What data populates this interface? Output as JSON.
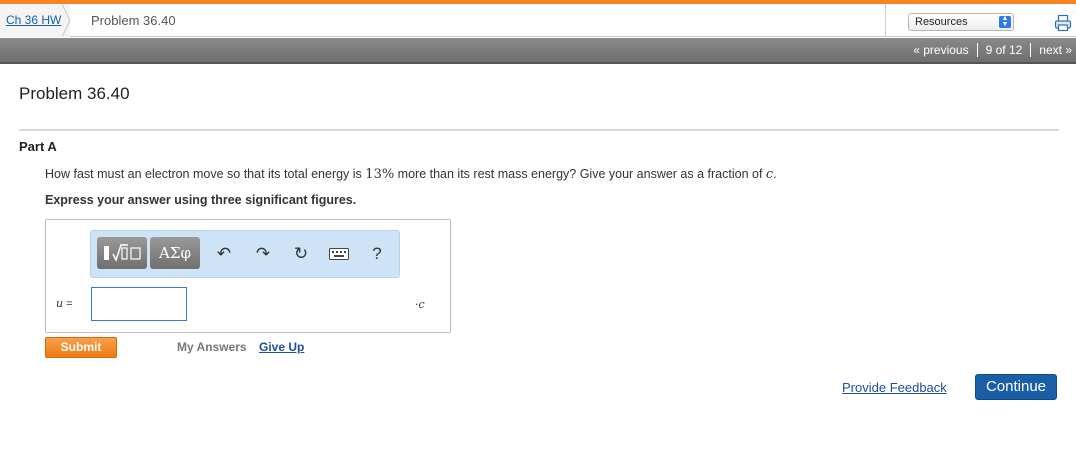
{
  "breadcrumb": {
    "home_label": "Ch 36 HW",
    "current_label": "Problem 36.40"
  },
  "resources": {
    "label": "Resources"
  },
  "pager": {
    "previous": "« previous",
    "position": "9 of 12",
    "next": "next »"
  },
  "page": {
    "title": "Problem 36.40"
  },
  "part": {
    "label": "Part A",
    "question_pre": "How fast must an electron move so that its total energy is ",
    "question_value": "13%",
    "question_post": " more than its rest mass energy? Give your answer as a fraction of ",
    "question_symbol": "c",
    "question_end": ".",
    "instruction": "Express your answer using three significant figures."
  },
  "answer": {
    "variable": "u",
    "equals": "=",
    "input_value": "",
    "unit": "·c",
    "toolbar": {
      "greek_label": "ΑΣφ",
      "help_label": "?"
    }
  },
  "actions": {
    "submit": "Submit",
    "my_answers": "My Answers",
    "give_up": "Give Up",
    "feedback": "Provide Feedback",
    "continue": "Continue"
  },
  "colors": {
    "accent": "#f7851f",
    "link": "#1a4f9c",
    "continue_bg": "#1a5ea8",
    "toolbar_bg": "#cfe3f7"
  },
  "icons": [
    "chevron-right-icon",
    "select-stepper-icon",
    "printer-icon",
    "template-icon",
    "undo-icon",
    "redo-icon",
    "reset-icon",
    "keyboard-icon",
    "help-icon"
  ]
}
